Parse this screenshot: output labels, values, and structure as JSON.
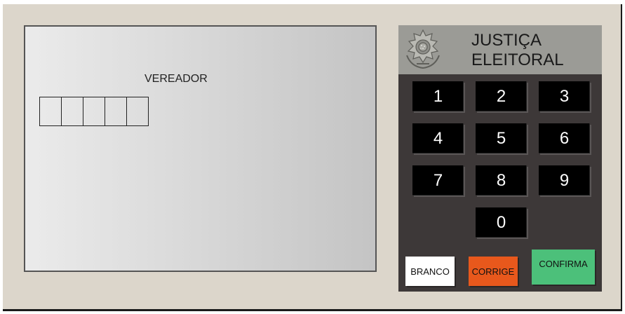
{
  "screen": {
    "office_label": "VEREADOR",
    "digit_slots": [
      "",
      "",
      "",
      "",
      ""
    ]
  },
  "panel": {
    "brand_line1": "JUSTIÇA",
    "brand_line2": "ELEITORAL",
    "emblem_icon": "coat-of-arms-icon"
  },
  "keypad": {
    "keys": [
      "1",
      "2",
      "3",
      "4",
      "5",
      "6",
      "7",
      "8",
      "9",
      "0"
    ]
  },
  "actions": {
    "branco": "BRANCO",
    "corrige": "CORRIGE",
    "confirma": "CONFIRMA"
  },
  "colors": {
    "branco": "#ffffff",
    "corrige": "#e8581c",
    "confirma": "#4cc07a",
    "panel": "#3d3838",
    "body": "#dcd6cb"
  }
}
